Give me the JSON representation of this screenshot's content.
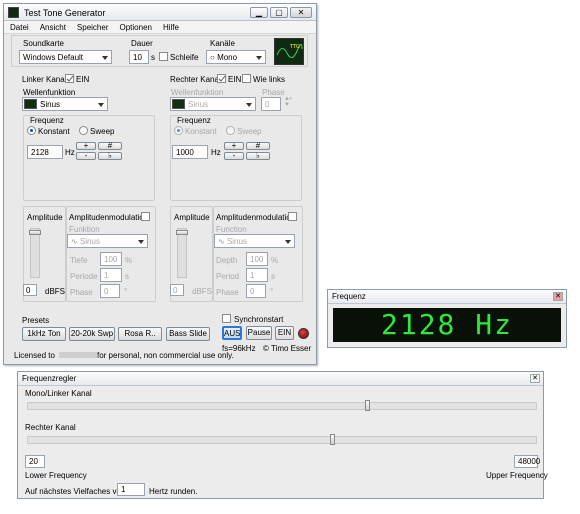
{
  "main": {
    "title": "Test Tone Generator",
    "menu": [
      "Datei",
      "Ansicht",
      "Speicher",
      "Optionen",
      "Hilfe"
    ],
    "soundcard": {
      "label": "Soundkarte",
      "value": "Windows Default"
    },
    "duration": {
      "label": "Dauer",
      "value": "10",
      "unit": "s",
      "loop": "Schleife"
    },
    "channels": {
      "label": "Kanäle",
      "value": "Mono"
    },
    "left": {
      "title": "Linker Kanal",
      "ein": "EIN",
      "wave_label": "Wellenfunktion",
      "wave": "Sinus",
      "freq_label": "Frequenz",
      "konstant": "Konstant",
      "sweep": "Sweep",
      "freq": "2128",
      "hz": "Hz",
      "amp_label": "Amplitude",
      "amp_value": "0",
      "dbfs": "dBFS",
      "am_label": "Amplitudenmodulation",
      "am_func_label": "Funktion",
      "am_func": "Sinus",
      "tiefe_label": "Tiefe",
      "tiefe": "100",
      "pct": "%",
      "periode_label": "Periode",
      "periode": "1",
      "s": "s",
      "phase_label": "Phase",
      "phase": "0",
      "deg": "°"
    },
    "right": {
      "title": "Rechter Kanal",
      "ein": "EIN",
      "wie_links": "Wie links",
      "wave_label": "Wellenfunktion",
      "wave": "Sinus",
      "phase_label": "Phase",
      "phase": "0",
      "freq_label": "Frequenz",
      "konstant": "Konstant",
      "sweep": "Sweep",
      "freq": "1000",
      "hz": "Hz",
      "amp_label": "Amplitude",
      "amp_value": "0",
      "dbfs": "dBFS",
      "am_label": "Amplitudenmodulation",
      "am_func_label": "Function",
      "am_func": "Sinus",
      "depth_label": "Depth",
      "depth": "100",
      "pct": "%",
      "period_label": "Period",
      "period": "1",
      "s": "s",
      "phase2_label": "Phase",
      "phase2": "0",
      "deg": "°"
    },
    "presets": {
      "label": "Presets",
      "items": [
        "1kHz Ton",
        "20-20k Swp",
        "Rosa R..",
        "Bass Slide"
      ]
    },
    "sync": "Synchronstart",
    "aus": "AUS",
    "pause": "Pause",
    "ein": "EIN",
    "fs": "fs=96kHz",
    "author": "© Timo Esser",
    "license_a": "Licensed to",
    "license_b": "for personal, non commercial use only.",
    "freq_btn_plus": "+",
    "freq_btn_minus": "-",
    "freq_btn_sharp": "#",
    "freq_btn_flat": "♭"
  },
  "freq_window": {
    "title": "Frequenz",
    "display": "2128 Hz"
  },
  "regler": {
    "title": "Frequenzregler",
    "mono_left": "Mono/Linker Kanal",
    "right": "Rechter Kanal",
    "low_value": "20",
    "high_value": "48000",
    "lower": "Lower Frequency",
    "upper": "Upper Frequency",
    "round_a": "Auf nächstes Vielfaches von",
    "round_value": "1",
    "round_b": "Hertz runden.",
    "slider_left_pos": 0.67,
    "slider_right_pos": 0.6
  },
  "colors": {
    "led_bg": "#081008",
    "led_fg": "#2ee83a",
    "aus": "#2b78d8",
    "led_red": "#a01010"
  }
}
